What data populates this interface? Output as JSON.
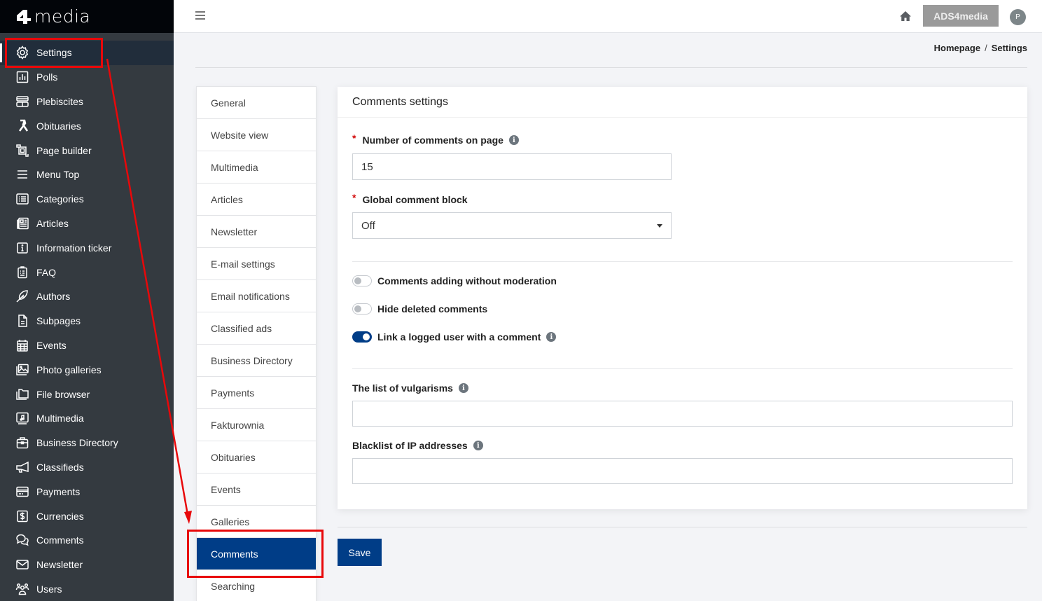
{
  "app": {
    "logo_text": "media",
    "brand_button": "ADS4media",
    "avatar_initial": "P"
  },
  "sidebar": {
    "items": [
      {
        "label": "Settings",
        "icon": "gear-icon",
        "active": true
      },
      {
        "label": "Polls",
        "icon": "poll-chart-icon"
      },
      {
        "label": "Plebiscites",
        "icon": "plebiscite-icon"
      },
      {
        "label": "Obituaries",
        "icon": "ribbon-icon"
      },
      {
        "label": "Page builder",
        "icon": "page-builder-icon"
      },
      {
        "label": "Menu Top",
        "icon": "menu-icon"
      },
      {
        "label": "Categories",
        "icon": "list-icon"
      },
      {
        "label": "Articles",
        "icon": "newspaper-icon"
      },
      {
        "label": "Information ticker",
        "icon": "info-square-icon"
      },
      {
        "label": "FAQ",
        "icon": "clipboard-icon"
      },
      {
        "label": "Authors",
        "icon": "feather-icon"
      },
      {
        "label": "Subpages",
        "icon": "file-icon"
      },
      {
        "label": "Events",
        "icon": "calendar-icon"
      },
      {
        "label": "Photo galleries",
        "icon": "images-icon"
      },
      {
        "label": "File browser",
        "icon": "folders-icon"
      },
      {
        "label": "Multimedia",
        "icon": "music-monitor-icon"
      },
      {
        "label": "Business Directory",
        "icon": "briefcase-icon"
      },
      {
        "label": "Classifieds",
        "icon": "megaphone-icon"
      },
      {
        "label": "Payments",
        "icon": "credit-card-icon"
      },
      {
        "label": "Currencies",
        "icon": "dollar-square-icon"
      },
      {
        "label": "Comments",
        "icon": "chat-icon"
      },
      {
        "label": "Newsletter",
        "icon": "envelope-icon"
      },
      {
        "label": "Users",
        "icon": "users-icon"
      }
    ]
  },
  "breadcrumb": {
    "home": "Homepage",
    "separator": "/",
    "current": "Settings"
  },
  "settings_tabs": [
    {
      "label": "General"
    },
    {
      "label": "Website view"
    },
    {
      "label": "Multimedia"
    },
    {
      "label": "Articles"
    },
    {
      "label": "Newsletter"
    },
    {
      "label": "E-mail settings"
    },
    {
      "label": "Email notifications"
    },
    {
      "label": "Classified ads"
    },
    {
      "label": "Business Directory"
    },
    {
      "label": "Payments"
    },
    {
      "label": "Fakturownia"
    },
    {
      "label": "Obituaries"
    },
    {
      "label": "Events"
    },
    {
      "label": "Galleries"
    },
    {
      "label": "Comments",
      "active": true
    },
    {
      "label": "Searching"
    }
  ],
  "card": {
    "title": "Comments settings",
    "comments_per_page": {
      "label": "Number of comments on page",
      "required": "*",
      "value": "15"
    },
    "global_block": {
      "label": "Global comment block",
      "required": "*",
      "value": "Off"
    },
    "toggles": [
      {
        "label": "Comments adding without moderation",
        "on": false
      },
      {
        "label": "Hide deleted comments",
        "on": false
      },
      {
        "label": "Link a logged user with a comment",
        "on": true
      }
    ],
    "vulgarisms": {
      "label": "The list of vulgarisms",
      "value": ""
    },
    "ip_blacklist": {
      "label": "Blacklist of IP addresses",
      "value": ""
    }
  },
  "actions": {
    "save_label": "Save"
  },
  "colors": {
    "primary": "#003d87",
    "sidebar_bg": "#343a40",
    "annotation": "#e8080a"
  }
}
